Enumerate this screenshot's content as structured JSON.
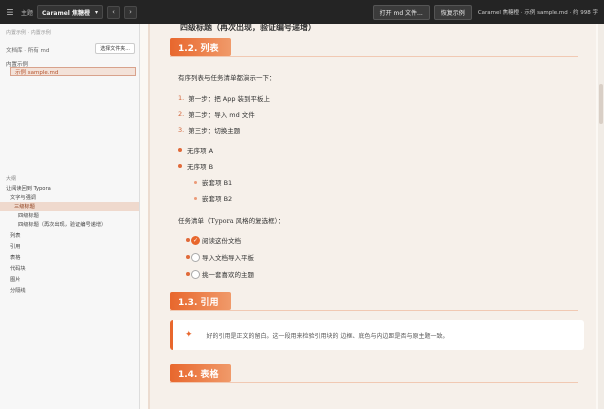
{
  "topbar": {
    "menu_icon": "menu-icon",
    "theme_label": "主题",
    "theme_value": "Caramel 焦糖橙",
    "prev": "‹",
    "next": "›",
    "open_button": "打开 md 文件...",
    "restore_button": "恢复示例",
    "status": "Caramel 焦糖橙 · 示例 sample.md · 约 998 字"
  },
  "sidebar": {
    "sub": "内置示例 · 内置示例",
    "dir_label": "文档库 · 所有 md",
    "choose_button": "选择文件夹...",
    "builtin_label": "内置示例",
    "file": "示例 sample.md",
    "outline_title": "大纲",
    "outline": [
      {
        "label": "让阅读回到 Typora",
        "level": 0
      },
      {
        "label": "文字与强调",
        "level": 1
      },
      {
        "label": "三级标题",
        "level": 2,
        "active": true
      },
      {
        "label": "四级标题",
        "level": 3
      },
      {
        "label": "四级标题（再次出现，验证编号递增）",
        "level": 3
      },
      {
        "label": "列表",
        "level": 1
      },
      {
        "label": "引用",
        "level": 1
      },
      {
        "label": "表格",
        "level": 1
      },
      {
        "label": "代码块",
        "level": 1
      },
      {
        "label": "图片",
        "level": 1
      },
      {
        "label": "分隔线",
        "level": 1
      }
    ]
  },
  "content": {
    "cut_heading": "四级标题（再次出现，验证编号递增）",
    "h_list": "1.2. 列表",
    "list_intro": "有序列表与任务清单都演示一下：",
    "ordered": [
      {
        "num": "1.",
        "text": "第一步：把 App 装到平板上"
      },
      {
        "num": "2.",
        "text": "第二步：导入 md 文件"
      },
      {
        "num": "3.",
        "text": "第三步：切换主题"
      }
    ],
    "unordered": [
      {
        "text": "无序项 A",
        "level": 0
      },
      {
        "text": "无序项 B",
        "level": 0
      },
      {
        "text": "嵌套项 B1",
        "level": 1
      },
      {
        "text": "嵌套项 B2",
        "level": 1
      }
    ],
    "task_intro": "任务清单（Typora 风格的复选框）：",
    "tasks": [
      {
        "text": "阅读这份文档",
        "checked": true
      },
      {
        "text": "导入文档导入平板",
        "checked": false
      },
      {
        "text": "挑一套喜欢的主题",
        "checked": false
      }
    ],
    "h_quote": "1.3. 引用",
    "quote_icon": "sparkle-icon",
    "quote_text": "好的引用是正文的留白。这一段用来检验引用块的 边框、底色与内边距是否与原主题一致。",
    "h_table": "1.4. 表格"
  },
  "colors": {
    "accent": "#e8672d",
    "topbar": "#242424",
    "sidebar_active": "#efd9cd"
  }
}
